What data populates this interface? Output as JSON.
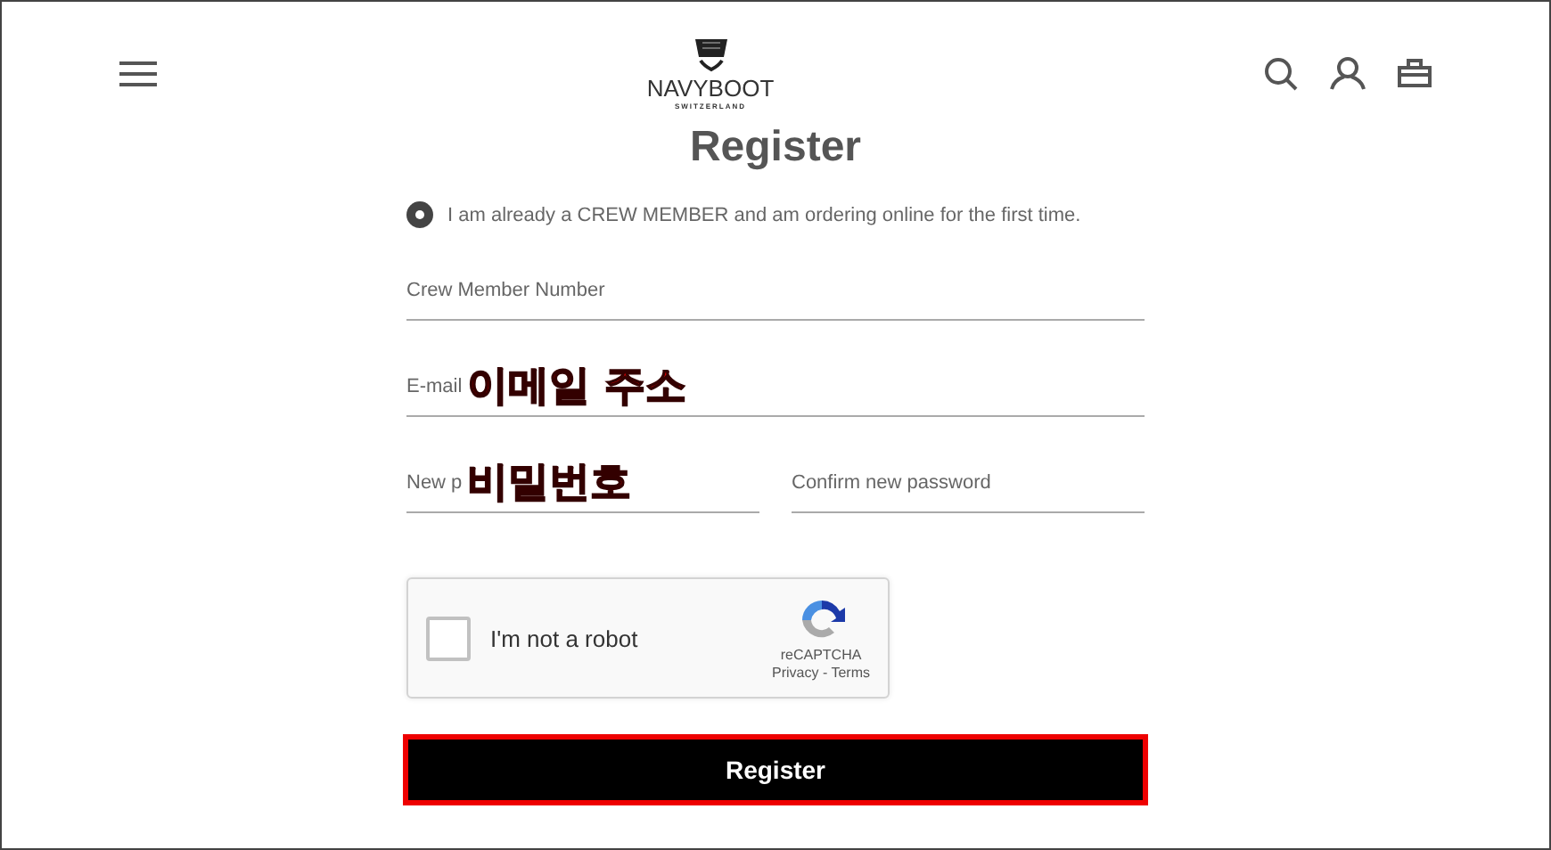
{
  "header": {
    "brand": "NAVYBOOT",
    "brand_sub": "SWITZERLAND"
  },
  "title": "Register",
  "member_option": {
    "label": "I am already a CREW MEMBER and am ordering online for the first time.",
    "selected": true
  },
  "fields": [
    {
      "label": "Crew Member Number"
    },
    {
      "label": "E-mail",
      "annotation": "이메일 주소"
    },
    {
      "label": "New p",
      "annotation": "비밀번호"
    },
    {
      "label": "Confirm new password"
    }
  ],
  "captcha": {
    "label": "I'm not a robot",
    "checked": false,
    "brand": "reCAPTCHA",
    "links": "Privacy - Terms"
  },
  "submit": {
    "label": "Register",
    "highlighted": true
  }
}
